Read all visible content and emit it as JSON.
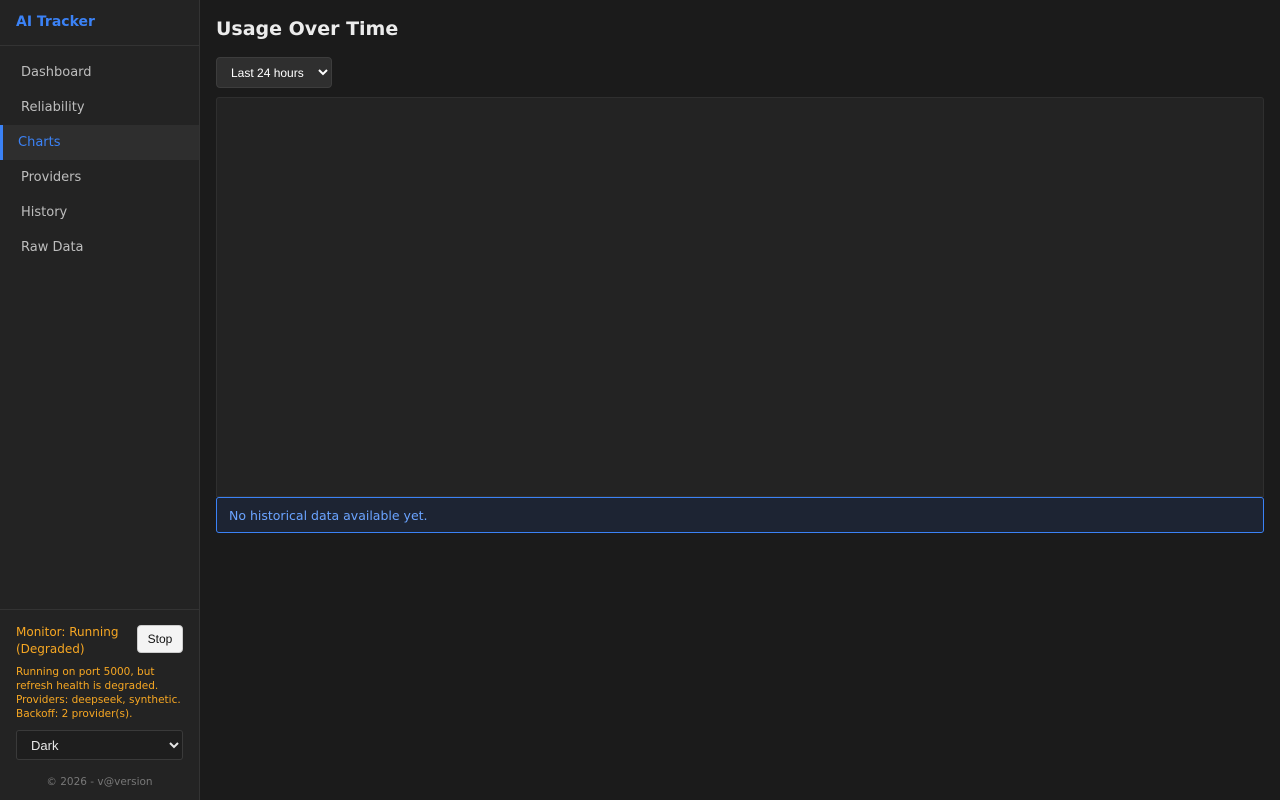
{
  "app": {
    "brand": "AI Tracker"
  },
  "sidebar": {
    "items": [
      {
        "label": "Dashboard",
        "active": false
      },
      {
        "label": "Reliability",
        "active": false
      },
      {
        "label": "Charts",
        "active": true
      },
      {
        "label": "Providers",
        "active": false
      },
      {
        "label": "History",
        "active": false
      },
      {
        "label": "Raw Data",
        "active": false
      }
    ],
    "footer": {
      "monitor_status": "Monitor: Running (Degraded)",
      "stop_label": "Stop",
      "detail": "Running on port 5000, but refresh health is degraded. Providers: deepseek, synthetic. Backoff: 2 provider(s).",
      "theme_selected": "Dark",
      "copyright": "© 2026 - v@version"
    }
  },
  "main": {
    "title": "Usage Over Time",
    "range_selected": "Last 24 hours",
    "empty_message": "No historical data available yet."
  },
  "colors": {
    "accent": "#3b82f6",
    "warning": "#f5a623",
    "background": "#1b1b1b",
    "sidebar_bg": "#232323"
  }
}
